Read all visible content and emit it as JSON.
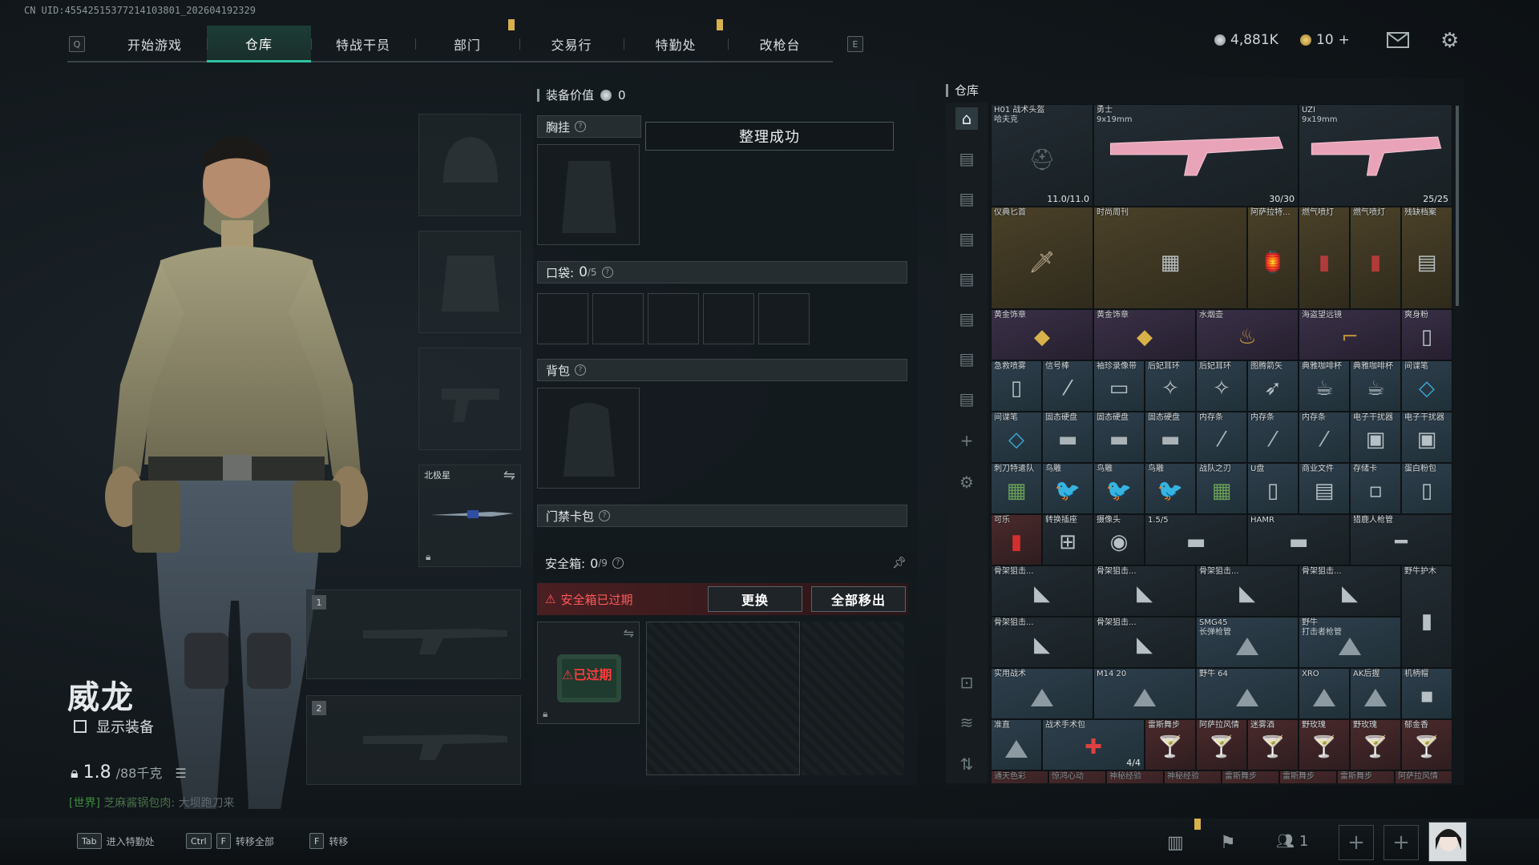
{
  "uid_text": "CN UID:45542515377214103801_202604192329",
  "nav": {
    "key_left": "Q",
    "key_right": "E",
    "tabs": [
      "开始游戏",
      "仓库",
      "特战干员",
      "部门",
      "交易行",
      "特勤处",
      "改枪台"
    ],
    "active_tab": 1
  },
  "currency": {
    "silver": "4,881K",
    "gold": "10",
    "plus": "+"
  },
  "character": {
    "name": "威龙",
    "show_equipment": "显示装备",
    "weight": "1.8",
    "weight_max": "/88千克",
    "chat_prefix": "[世界]",
    "chat_player": "芝麻酱锅包肉:",
    "chat_text": "大坝跑刀来"
  },
  "equipment_slots": {
    "melee_name": "北极星",
    "primary_1": "1",
    "primary_2": "2"
  },
  "middle": {
    "equip_value_label": "装备价值",
    "equip_value": "0",
    "chest_rig": "胸挂",
    "toast": "整理成功",
    "pocket_label": "口袋:",
    "pocket_count": "0",
    "pocket_max": "/5",
    "backpack": "背包",
    "keycard": "门禁卡包",
    "safe_label": "安全箱:",
    "safe_count": "0",
    "safe_max": "/9",
    "expired_warning": "安全箱已过期",
    "replace_button": "更换",
    "remove_all_button": "全部移出",
    "expired_tag": "已过期"
  },
  "warehouse": {
    "title": "仓库",
    "items": [
      {
        "label": "H01 战术头盔",
        "sub": "哈夫克",
        "count": "11.0/11.0",
        "icon": "helmet-icon",
        "color": "dark"
      },
      {
        "label": "勇士",
        "sub": "9x19mm",
        "count": "30/30",
        "icon": "rifle-icon",
        "color": "dark"
      },
      {
        "label": "UZI",
        "sub": "9x19mm",
        "count": "25/25",
        "icon": "smg-icon",
        "color": "dark"
      },
      {
        "label": "仪典匕首",
        "icon": "dagger-icon",
        "color": "gold"
      },
      {
        "label": "时尚周刊",
        "icon": "magazine-icon",
        "color": "gold"
      },
      {
        "label": "阿萨拉特...",
        "icon": "lantern-icon",
        "color": "gold"
      },
      {
        "label": "燃气喷灯",
        "icon": "torch-icon",
        "color": "gold"
      },
      {
        "label": "燃气喷灯",
        "icon": "torch-icon",
        "color": "gold"
      },
      {
        "label": "残缺档案",
        "icon": "file-icon",
        "color": "gold"
      },
      {
        "label": "黄金饰章",
        "icon": "emblem-icon",
        "color": "purp"
      },
      {
        "label": "黄金饰章",
        "icon": "emblem-icon",
        "color": "purp"
      },
      {
        "label": "水烟壶",
        "icon": "hookah-icon",
        "color": "purp"
      },
      {
        "label": "海盗望远镜",
        "icon": "telescope-icon",
        "color": "purp"
      },
      {
        "label": "爽身粉",
        "icon": "powder-icon",
        "color": "purp"
      },
      {
        "label": "急救喷雾",
        "icon": "spray-icon",
        "color": ""
      },
      {
        "label": "信号棒",
        "icon": "flare-icon",
        "color": ""
      },
      {
        "label": "袖珍录像带",
        "icon": "tape-icon",
        "color": ""
      },
      {
        "label": "后妃耳环",
        "icon": "earring-icon",
        "color": ""
      },
      {
        "label": "后妃耳环",
        "icon": "earring-icon",
        "color": ""
      },
      {
        "label": "图腾箭矢",
        "icon": "arrow-icon",
        "color": ""
      },
      {
        "label": "典雅咖啡杯",
        "icon": "cup-icon",
        "color": ""
      },
      {
        "label": "典雅咖啡杯",
        "icon": "cup-icon",
        "color": ""
      },
      {
        "label": "间谍笔",
        "icon": "pen-icon",
        "color": ""
      },
      {
        "label": "间谍笔",
        "icon": "pen-icon",
        "color": ""
      },
      {
        "label": "固态硬盘",
        "icon": "ssd-icon",
        "color": ""
      },
      {
        "label": "固态硬盘",
        "icon": "ssd-icon",
        "color": ""
      },
      {
        "label": "固态硬盘",
        "icon": "ssd-icon",
        "color": ""
      },
      {
        "label": "内存条",
        "icon": "ram-icon",
        "color": ""
      },
      {
        "label": "内存条",
        "icon": "ram-icon",
        "color": ""
      },
      {
        "label": "内存条",
        "icon": "ram-icon",
        "color": ""
      },
      {
        "label": "电子干扰器",
        "icon": "jammer-icon",
        "color": ""
      },
      {
        "label": "电子干扰器",
        "icon": "jammer-icon",
        "color": ""
      },
      {
        "label": "刺刀特遣队",
        "icon": "card-icon",
        "color": ""
      },
      {
        "label": "鸟雕",
        "icon": "bird-icon",
        "color": ""
      },
      {
        "label": "鸟雕",
        "icon": "bird-icon",
        "color": ""
      },
      {
        "label": "鸟雕",
        "icon": "bird-icon",
        "color": ""
      },
      {
        "label": "战队之刃",
        "icon": "card-icon",
        "color": ""
      },
      {
        "label": "U盘",
        "icon": "usb-icon",
        "color": ""
      },
      {
        "label": "商业文件",
        "icon": "document-icon",
        "color": ""
      },
      {
        "label": "存储卡",
        "icon": "sdcard-icon",
        "color": ""
      },
      {
        "label": "蛋白粉包",
        "icon": "bag-icon",
        "color": ""
      },
      {
        "label": "可乐",
        "icon": "can-icon",
        "color": "red"
      },
      {
        "label": "转换插座",
        "icon": "plug-icon",
        "color": "dark"
      },
      {
        "label": "摄像头",
        "icon": "camera-icon",
        "color": "dark"
      },
      {
        "label": "1.5/5",
        "icon": "scope-icon",
        "color": "dark"
      },
      {
        "label": "HAMR",
        "icon": "scope-icon",
        "color": "dark"
      },
      {
        "label": "猎鹿人枪管",
        "icon": "barrel-icon",
        "color": "dark"
      },
      {
        "label": "骨架狙击...",
        "icon": "stock-icon",
        "color": "dark"
      },
      {
        "label": "骨架狙击...",
        "icon": "stock-icon",
        "color": "dark"
      },
      {
        "label": "骨架狙击...",
        "icon": "stock-icon",
        "color": "dark"
      },
      {
        "label": "骨架狙击...",
        "icon": "stock-icon",
        "color": "dark"
      },
      {
        "label": "野牛护木",
        "icon": "handguard-icon",
        "color": "dark"
      },
      {
        "label": "骨架狙击...",
        "icon": "stock-icon",
        "color": "dark"
      },
      {
        "label": "骨架狙击...",
        "icon": "stock-icon",
        "color": "dark"
      },
      {
        "label": "SMG45",
        "sub": "长弹枪管",
        "icon": "attachment-icon",
        "color": ""
      },
      {
        "label": "野牛",
        "sub": "打击者枪管",
        "icon": "attachment-icon",
        "color": ""
      },
      {
        "label": "实用战术",
        "icon": "attachment-icon",
        "color": ""
      },
      {
        "label": "M14 20",
        "icon": "attachment-icon",
        "color": ""
      },
      {
        "label": "野牛 64",
        "icon": "attachment-icon",
        "color": ""
      },
      {
        "label": "XRO",
        "icon": "attachment-icon",
        "color": ""
      },
      {
        "label": "AK后握",
        "icon": "attachment-icon",
        "color": ""
      },
      {
        "label": "机柄帽",
        "icon": "cap-icon",
        "color": ""
      },
      {
        "label": "准直",
        "icon": "attachment-icon",
        "color": ""
      },
      {
        "label": "战术手术包",
        "count": "4/4",
        "icon": "medkit-icon",
        "color": ""
      },
      {
        "label": "雷斯舞步",
        "icon": "drink-icon",
        "color": "red"
      },
      {
        "label": "阿萨拉风情",
        "icon": "drink-icon",
        "color": "red"
      },
      {
        "label": "迷雾酒",
        "icon": "drink-icon",
        "color": "red"
      },
      {
        "label": "野玫瑰",
        "icon": "drink-icon",
        "color": "red"
      },
      {
        "label": "野玫瑰",
        "icon": "drink-icon",
        "color": "red"
      },
      {
        "label": "郁金香",
        "icon": "drink-icon",
        "color": "red"
      }
    ],
    "bottom_row": [
      "通天色彩",
      "惊鸿心动",
      "神秘经验",
      "神秘经验",
      "雷斯舞步",
      "雷斯舞步",
      "雷斯舞步",
      "阿萨拉风情"
    ]
  },
  "bottom_bar": {
    "hints": [
      {
        "key": "Tab",
        "label": "进入特勤处"
      },
      {
        "key": "Ctrl",
        "key2": "F",
        "label": "转移全部"
      },
      {
        "key": "F",
        "label": "转移"
      }
    ],
    "squad_count": "1"
  }
}
